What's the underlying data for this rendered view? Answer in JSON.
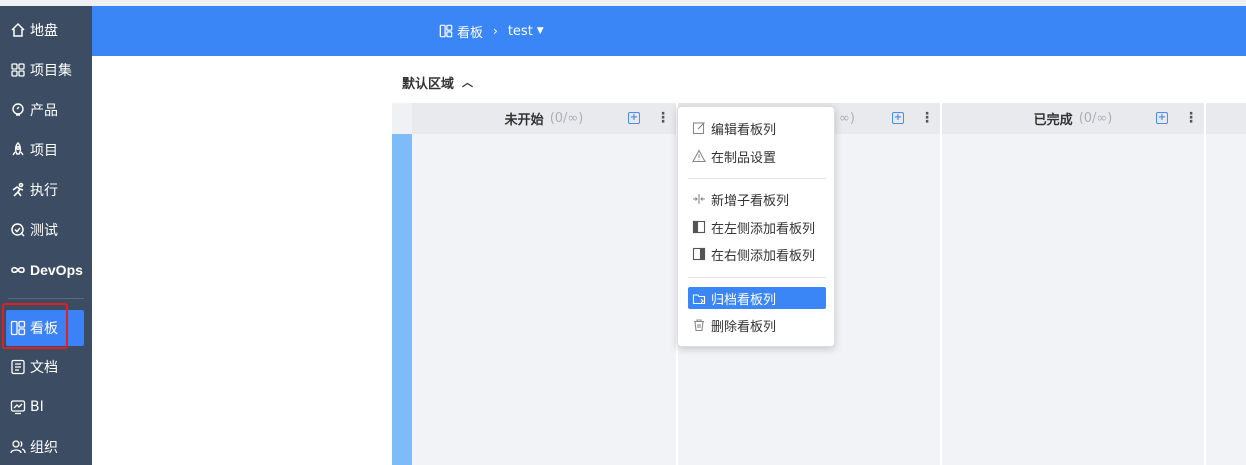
{
  "sidebar": {
    "items": [
      {
        "label": "地盘",
        "icon": "home-icon"
      },
      {
        "label": "项目集",
        "icon": "grid-icon"
      },
      {
        "label": "产品",
        "icon": "bulb-icon"
      },
      {
        "label": "项目",
        "icon": "rocket-icon"
      },
      {
        "label": "执行",
        "icon": "run-icon"
      },
      {
        "label": "测试",
        "icon": "test-icon"
      },
      {
        "label": "DevOps",
        "icon": "infinity-icon"
      },
      {
        "label": "看板",
        "icon": "kanban-icon"
      },
      {
        "label": "文档",
        "icon": "doc-icon"
      },
      {
        "label": "BI",
        "icon": "monitor-icon"
      },
      {
        "label": "组织",
        "icon": "people-icon"
      }
    ],
    "active_index": 7
  },
  "header": {
    "breadcrumb_root": "看板",
    "breadcrumb_current": "test"
  },
  "area": {
    "title": "默认区域"
  },
  "columns": [
    {
      "name": "未开始",
      "count": "(0/∞)"
    },
    {
      "name": "",
      "count": "∞)"
    },
    {
      "name": "已完成",
      "count": "(0/∞)"
    }
  ],
  "menu": {
    "items": [
      {
        "label": "编辑看板列",
        "icon": "edit-icon"
      },
      {
        "label": "在制品设置",
        "icon": "warning-icon"
      },
      {
        "label": "新增子看板列",
        "icon": "split-icon"
      },
      {
        "label": "在左侧添加看板列",
        "icon": "column-left-icon"
      },
      {
        "label": "在右侧添加看板列",
        "icon": "column-right-icon"
      },
      {
        "label": "归档看板列",
        "icon": "archive-icon"
      },
      {
        "label": "删除看板列",
        "icon": "trash-icon"
      }
    ],
    "highlighted_index": 5
  },
  "colors": {
    "sidebar_bg": "#3c4d63",
    "accent": "#3b86f7",
    "swimlane": "#7dbcf9",
    "highlight_border": "#e02020"
  }
}
